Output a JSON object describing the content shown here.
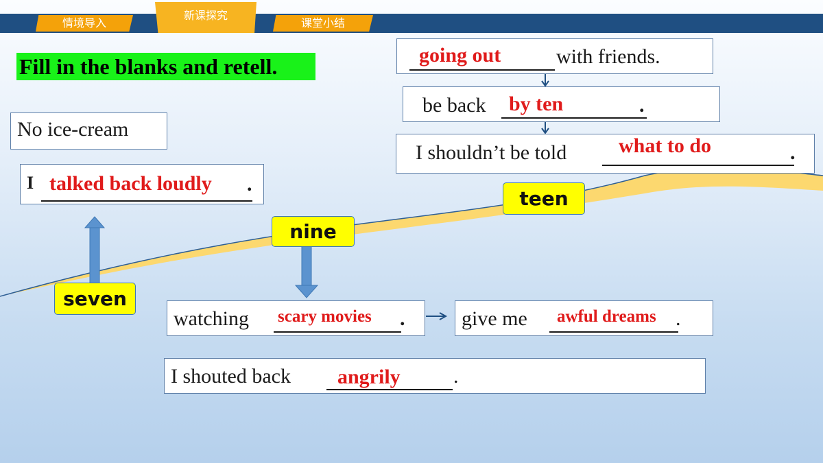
{
  "nav": {
    "tabs": [
      "情境导入",
      "新课探究",
      "课堂小结"
    ]
  },
  "title": "Fill in the blanks and retell.",
  "ages": {
    "seven": "seven",
    "nine": "nine",
    "teen": "teen"
  },
  "boxes": {
    "ice_cream": {
      "text": "No ice-cream"
    },
    "talked_back": {
      "prefix": "I",
      "answer": "talked back loudly",
      "suffix": "."
    },
    "watching": {
      "prefix": "watching",
      "answer": "scary movies",
      "suffix": "."
    },
    "dreams": {
      "prefix": "give me",
      "answer": "awful dreams",
      "suffix": "."
    },
    "shouted": {
      "prefix": "I shouted back",
      "answer": "angrily",
      "suffix": "."
    },
    "going_out": {
      "answer": "going out",
      "suffix": "with friends."
    },
    "be_back": {
      "prefix": "be back",
      "answer": "by ten",
      "suffix": "."
    },
    "told": {
      "prefix": "I shouldn’t be told",
      "answer": "what to do",
      "suffix": "."
    }
  },
  "colors": {
    "answer": "#e01b1b",
    "title_bg": "#19f219",
    "label_bg": "#ffff00",
    "nav_bar": "#1f4f82",
    "tab": "#f4a20a",
    "curve_fill": "#fcd86f"
  }
}
